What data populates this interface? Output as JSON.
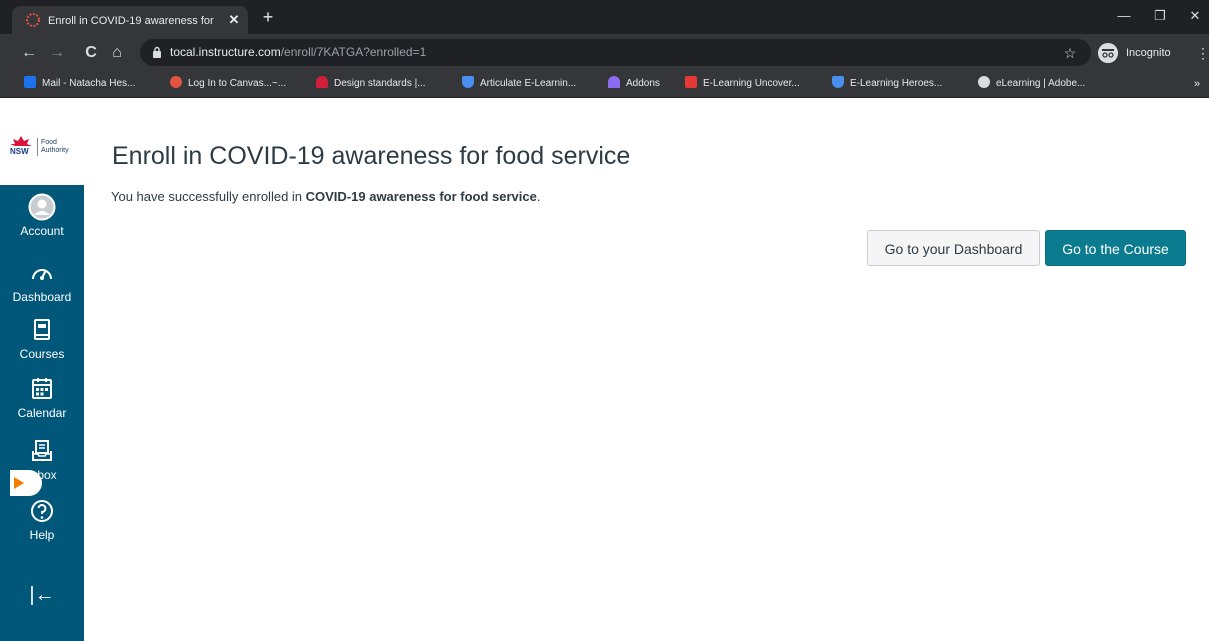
{
  "browser": {
    "tab_title": "Enroll in COVID-19 awareness for",
    "tab_close": "✕",
    "new_tab": "+",
    "window_controls": {
      "minimize": "—",
      "restore": "❐",
      "close": "✕"
    },
    "nav": {
      "back": "←",
      "forward": "→",
      "reload": "C",
      "home": "⌂"
    },
    "url_host": "tocal.instructure.com",
    "url_path": "/enroll/7KATGA?enrolled=1",
    "bookmark_star": "☆",
    "profile_label": "Incognito",
    "menu": "⋮",
    "bookmarks": [
      {
        "label": "Mail - Natacha Hes...",
        "color": "#1a73e8"
      },
      {
        "label": "Log In to Canvas...~...",
        "color": "#e2543f"
      },
      {
        "label": "Design standards |...",
        "color": "#d3203a"
      },
      {
        "label": "Articulate E-Learnin...",
        "color": "#4a8ff0"
      },
      {
        "label": "Addons",
        "color": "#8c6cf0"
      },
      {
        "label": "E-Learning Uncover...",
        "color": "#e53935"
      },
      {
        "label": "E-Learning Heroes...",
        "color": "#4a8ff0"
      },
      {
        "label": "eLearning | Adobe...",
        "color": "#dadce0"
      }
    ],
    "bookmarks_more": "»"
  },
  "brand": {
    "nsw": "NSW",
    "food_authority": "Food Authority"
  },
  "sidebar": {
    "items": [
      {
        "label": "Account"
      },
      {
        "label": "Dashboard"
      },
      {
        "label": "Courses"
      },
      {
        "label": "Calendar"
      },
      {
        "label": "Inbox"
      },
      {
        "label": "Help"
      }
    ],
    "collapse": "|←"
  },
  "main": {
    "title": "Enroll in COVID-19 awareness for food service",
    "message_prefix": "You have successfully enrolled in ",
    "message_course": "COVID-19 awareness for food service",
    "message_suffix": ".",
    "dashboard_button": "Go to your Dashboard",
    "course_button": "Go to the Course"
  },
  "colors": {
    "sidebar": "#00577a",
    "primary": "#0b7c8f",
    "text": "#2d3b45"
  }
}
